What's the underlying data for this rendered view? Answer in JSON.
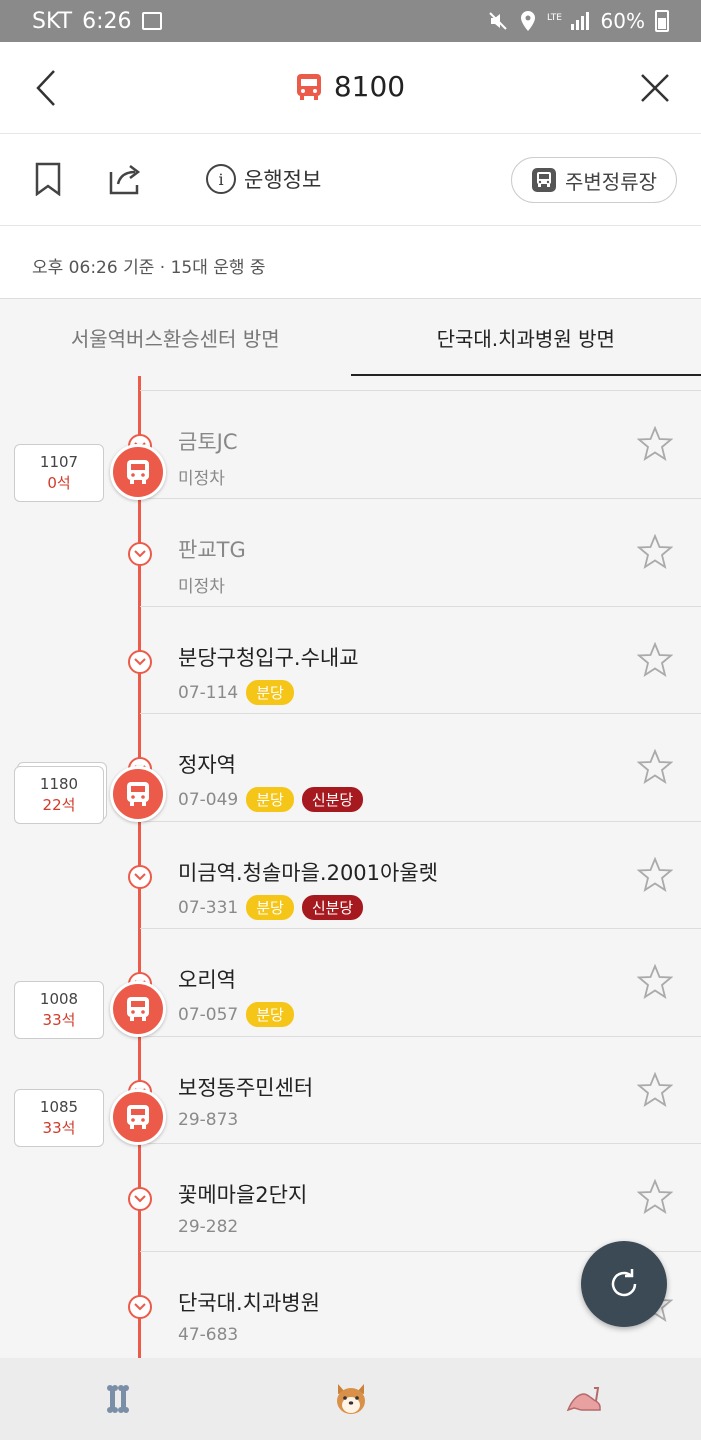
{
  "status_bar": {
    "carrier": "SKT",
    "time": "6:26",
    "battery": "60%"
  },
  "header": {
    "title": "8100"
  },
  "toolbar": {
    "info_label": "운행정보",
    "info_glyph": "i",
    "nearby_label": "주변정류장"
  },
  "status_line": "오후 06:26 기준 · 15대 운행 중",
  "tabs": [
    {
      "label": "서울역버스환승센터 방면"
    },
    {
      "label": "단국대.치과병원 방면"
    }
  ],
  "stops": [
    {
      "name": "금토JC",
      "code": "미정차",
      "badges": []
    },
    {
      "name": "판교TG",
      "code": "미정차",
      "badges": []
    },
    {
      "name": "분당구청입구.수내교",
      "code": "07-114",
      "badges": [
        "분당"
      ]
    },
    {
      "name": "정자역",
      "code": "07-049",
      "badges": [
        "분당",
        "신분당"
      ]
    },
    {
      "name": "미금역.청솔마을.2001아울렛",
      "code": "07-331",
      "badges": [
        "분당",
        "신분당"
      ]
    },
    {
      "name": "오리역",
      "code": "07-057",
      "badges": [
        "분당"
      ]
    },
    {
      "name": "보정동주민센터",
      "code": "29-873",
      "badges": []
    },
    {
      "name": "꽃메마을2단지",
      "code": "29-282",
      "badges": []
    },
    {
      "name": "단국대.치과병원",
      "code": "47-683",
      "badges": []
    }
  ],
  "buses": [
    {
      "number": "1107",
      "seats": "0석"
    },
    {
      "number": "1180",
      "seats": "22석"
    },
    {
      "number": "1008",
      "seats": "33석"
    },
    {
      "number": "1085",
      "seats": "33석"
    }
  ],
  "colors": {
    "accent": "#ec5a4a",
    "badge_yellow": "#f5c518",
    "badge_red": "#a5191f",
    "fab": "#3c4a55"
  },
  "icons": [
    "back-icon",
    "bus-icon",
    "close-icon",
    "bookmark-icon",
    "share-icon",
    "info-icon",
    "bus-stop-icon",
    "star-icon",
    "chevron-down-icon",
    "refresh-icon",
    "bone-icon",
    "dog-icon",
    "shoe-icon"
  ]
}
